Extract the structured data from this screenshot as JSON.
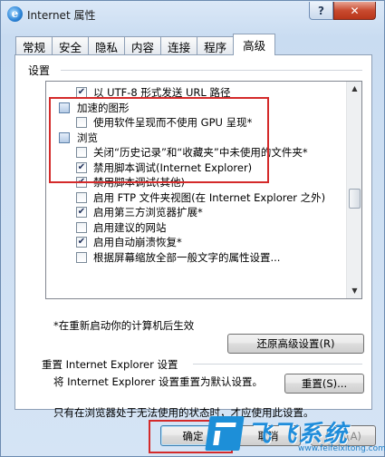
{
  "window": {
    "title": "Internet 属性",
    "help_symbol": "?",
    "close_symbol": "✕"
  },
  "tabs": [
    "常规",
    "安全",
    "隐私",
    "内容",
    "连接",
    "程序",
    "高级"
  ],
  "settings": {
    "group_label": "设置",
    "rows": [
      {
        "kind": "checkbox",
        "checked": true,
        "label": "以 UTF-8 形式发送 URL 路径"
      },
      {
        "kind": "category",
        "label": "加速的图形"
      },
      {
        "kind": "checkbox",
        "checked": false,
        "label": "使用软件呈现而不使用 GPU 呈现*"
      },
      {
        "kind": "category",
        "label": "浏览"
      },
      {
        "kind": "checkbox",
        "checked": false,
        "label": "关闭“历史记录”和“收藏夹”中未使用的文件夹*"
      },
      {
        "kind": "checkbox",
        "checked": true,
        "label": "禁用脚本调试(Internet Explorer)"
      },
      {
        "kind": "checkbox",
        "checked": true,
        "label": "禁用脚本调试(其他)"
      },
      {
        "kind": "checkbox",
        "checked": false,
        "label": "启用 FTP 文件夹视图(在 Internet Explorer 之外)"
      },
      {
        "kind": "checkbox",
        "checked": true,
        "label": "启用第三方浏览器扩展*"
      },
      {
        "kind": "checkbox",
        "checked": false,
        "label": "启用建议的网站"
      },
      {
        "kind": "checkbox",
        "checked": true,
        "label": "启用自动崩溃恢复*"
      },
      {
        "kind": "checkbox",
        "checked": false,
        "label": "根据屏幕缩放全部一般文字的属性设置..."
      }
    ],
    "restart_note": "*在重新启动你的计算机后生效",
    "restore_button": "还原高级设置(R)"
  },
  "reset": {
    "title": "重置 Internet Explorer 设置",
    "description": "将 Internet Explorer 设置重置为默认设置。",
    "button": "重置(S)...",
    "hint": "只有在浏览器处于无法使用的状态时，才应使用此设置。"
  },
  "footer": {
    "ok": "确定",
    "cancel": "取消",
    "apply": "应用(A)"
  },
  "watermark": {
    "text": "飞飞系统",
    "url": "www.feifeixitong.com"
  },
  "colors": {
    "highlight": "#d42a2a",
    "accent": "#1f8ddb"
  }
}
